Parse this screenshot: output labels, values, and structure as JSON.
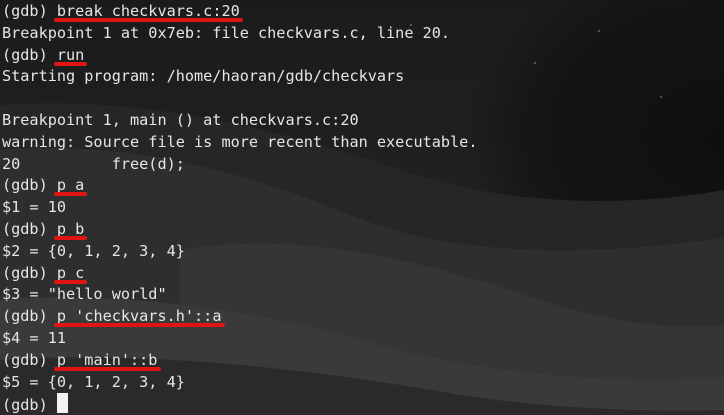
{
  "terminal": {
    "lines": [
      {
        "prompt": "(gdb) ",
        "text": "break checkvars.c:20",
        "underlined": true
      },
      {
        "prompt": "",
        "text": "Breakpoint 1 at 0x7eb: file checkvars.c, line 20."
      },
      {
        "prompt": "(gdb) ",
        "text": "run",
        "underlined": true
      },
      {
        "prompt": "",
        "text": "Starting program: /home/haoran/gdb/checkvars"
      },
      {
        "prompt": "",
        "text": ""
      },
      {
        "prompt": "",
        "text": "Breakpoint 1, main () at checkvars.c:20"
      },
      {
        "prompt": "",
        "text": "warning: Source file is more recent than executable."
      },
      {
        "prompt": "",
        "text": "20          free(d);"
      },
      {
        "prompt": "(gdb) ",
        "text": "p a",
        "underlined": true
      },
      {
        "prompt": "",
        "text": "$1 = 10"
      },
      {
        "prompt": "(gdb) ",
        "text": "p b",
        "underlined": true
      },
      {
        "prompt": "",
        "text": "$2 = {0, 1, 2, 3, 4}"
      },
      {
        "prompt": "(gdb) ",
        "text": "p c",
        "underlined": true
      },
      {
        "prompt": "",
        "text": "$3 = \"hello world\""
      },
      {
        "prompt": "(gdb) ",
        "text": "p 'checkvars.h'::a",
        "underlined": true
      },
      {
        "prompt": "",
        "text": "$4 = 11"
      },
      {
        "prompt": "(gdb) ",
        "text": "p 'main'::b",
        "underlined": true
      },
      {
        "prompt": "",
        "text": "$5 = {0, 1, 2, 3, 4}"
      },
      {
        "prompt": "(gdb) ",
        "text": "",
        "cursor": true
      }
    ]
  },
  "colors": {
    "text": "#e6e6e6",
    "annotation_underline": "#e11414",
    "cursor": "#f2f2f2"
  }
}
